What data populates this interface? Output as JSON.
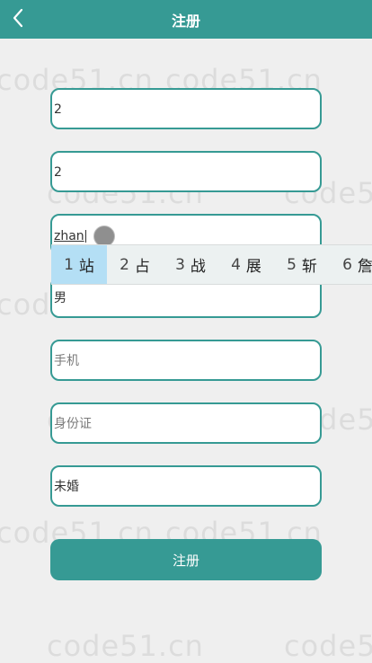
{
  "header": {
    "title": "注册",
    "back_icon": "chevron-left-icon"
  },
  "watermark": "code51.cn",
  "form": {
    "fields": [
      {
        "value": "2",
        "placeholder": ""
      },
      {
        "value": "2",
        "placeholder": ""
      },
      {
        "value": "zhan",
        "placeholder": ""
      },
      {
        "value": "男",
        "placeholder": ""
      },
      {
        "value": "",
        "placeholder": "手机"
      },
      {
        "value": "",
        "placeholder": "身份证"
      },
      {
        "value": "未婚",
        "placeholder": ""
      }
    ],
    "submit_label": "注册"
  },
  "ime": {
    "candidates": [
      {
        "num": "1",
        "text": "站"
      },
      {
        "num": "2",
        "text": "占"
      },
      {
        "num": "3",
        "text": "战"
      },
      {
        "num": "4",
        "text": "展"
      },
      {
        "num": "5",
        "text": "斩"
      },
      {
        "num": "6",
        "text": "詹"
      }
    ]
  },
  "colors": {
    "accent": "#369a94",
    "background": "#efefef",
    "ime_highlight": "#b4dff5"
  }
}
